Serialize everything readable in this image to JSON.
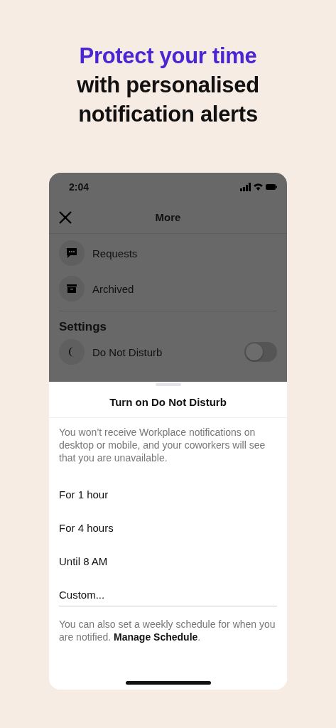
{
  "headline": {
    "lines": [
      {
        "text": "Protect your time",
        "kind": "accent"
      },
      {
        "text": "with personalised",
        "kind": "plain"
      },
      {
        "text": "notification alerts",
        "kind": "plain"
      }
    ]
  },
  "status_bar": {
    "time": "2:04"
  },
  "header": {
    "title": "More"
  },
  "menu": [
    {
      "label": "Requests",
      "kind": "requests"
    },
    {
      "label": "Archived",
      "kind": "archive"
    }
  ],
  "settings": {
    "heading": "Settings",
    "items": [
      {
        "label": "Do Not Disturb",
        "kind": "moon",
        "on": false
      }
    ]
  },
  "sheet": {
    "title": "Turn on Do Not Disturb",
    "description": "You won’t receive Workplace notifications on desktop or mobile, and your coworkers will see that you are unavailable.",
    "options": [
      "For 1 hour",
      "For 4 hours",
      "Until 8 AM",
      "Custom..."
    ],
    "footer": {
      "text": "You can also set a weekly schedule for when you are notified.",
      "link": "Manage Schedule",
      "end": "."
    }
  }
}
